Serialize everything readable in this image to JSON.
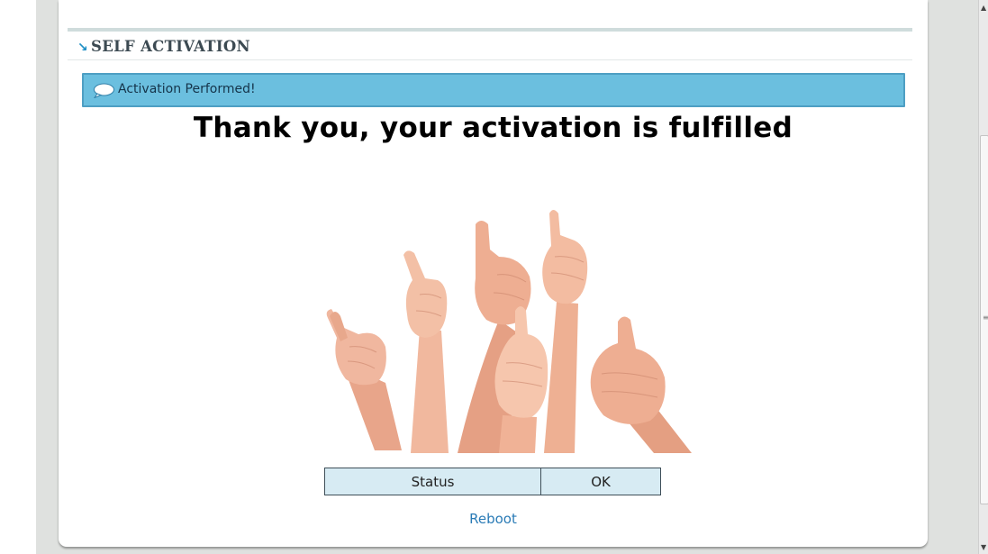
{
  "section": {
    "arrow": "↘",
    "title": "SELF ACTIVATION"
  },
  "alert": {
    "message": "Activation Performed!",
    "icon": "speech-bubble-icon"
  },
  "headline": "Thank you, your activation is fulfilled",
  "status_table": {
    "label": "Status",
    "value": "OK"
  },
  "reboot_label": "Reboot",
  "colors": {
    "alert_bg": "#6bbfdf",
    "link": "#2a7bb6",
    "table_bg": "#d7ebf3"
  }
}
